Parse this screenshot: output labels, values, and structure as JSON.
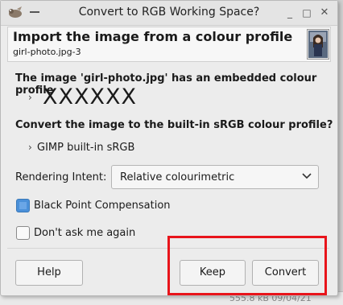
{
  "window": {
    "title": "Convert to RGB Working Space?",
    "controls": [
      "_",
      "□",
      "✕"
    ]
  },
  "header": {
    "title": "Import the image from a colour profile",
    "subtitle": "girl-photo.jpg-3"
  },
  "message": {
    "embedded_text": "The image 'girl-photo.jpg' has an embedded colour profile",
    "embedded_profile": "XXXXXX",
    "question": "Convert the image to the built-in sRGB colour profile?",
    "target_profile": "GIMP built-in sRGB",
    "expander_glyph": "›"
  },
  "rendering_intent": {
    "label": "Rendering Intent:",
    "value": "Relative colourimetric"
  },
  "options": {
    "black_point": {
      "label": "Black Point Compensation",
      "checked": true
    },
    "dont_ask": {
      "label": "Don't ask me again",
      "checked": false
    }
  },
  "buttons": {
    "help": "Help",
    "keep": "Keep",
    "convert": "Convert"
  },
  "background_status": "555.8 kB   09/04/21",
  "colors": {
    "highlight": "#e8141b",
    "check_accent": "#4a90d9"
  }
}
